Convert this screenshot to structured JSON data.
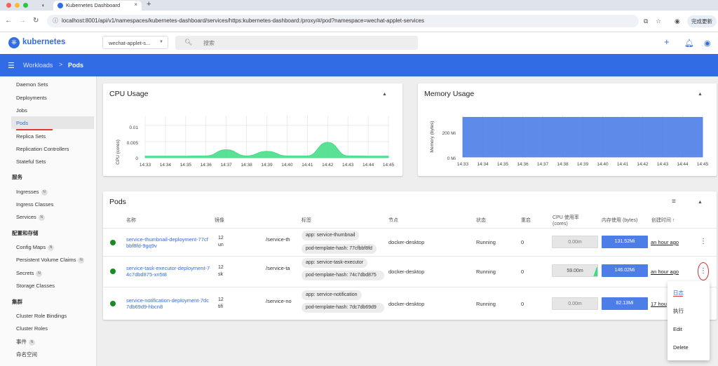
{
  "browser": {
    "tab_title": "Kubernetes Dashboard",
    "tab_close": "×",
    "new_tab": "+",
    "url": "localhost:8001/api/v1/namespaces/kubernetes-dashboard/services/https:kubernetes-dashboard:/proxy/#/pod?namespace=wechat-applet-services",
    "update_label": "完成更新"
  },
  "app": {
    "logo_text": "kubernetes",
    "namespace": "wechat-applet-s...",
    "search_placeholder": "搜索"
  },
  "breadcrumb": {
    "parent": "Workloads",
    "separator": ">",
    "current": "Pods"
  },
  "sidebar": {
    "workload_items": [
      {
        "label": "Daemon Sets"
      },
      {
        "label": "Deployments"
      },
      {
        "label": "Jobs"
      },
      {
        "label": "Pods"
      },
      {
        "label": "Replica Sets"
      },
      {
        "label": "Replication Controllers"
      },
      {
        "label": "Stateful Sets"
      }
    ],
    "service_header": "服务",
    "service_items": [
      {
        "label": "Ingresses",
        "badge": "N"
      },
      {
        "label": "Ingress Classes"
      },
      {
        "label": "Services",
        "badge": "N"
      }
    ],
    "config_header": "配置和存储",
    "config_items": [
      {
        "label": "Config Maps",
        "badge": "N"
      },
      {
        "label": "Persistent Volume Claims",
        "badge": "N"
      },
      {
        "label": "Secrets",
        "badge": "N"
      },
      {
        "label": "Storage Classes"
      }
    ],
    "cluster_header": "集群",
    "cluster_items": [
      {
        "label": "Cluster Role Bindings"
      },
      {
        "label": "Cluster Roles"
      },
      {
        "label": "事件",
        "badge": "N"
      },
      {
        "label": "命名空间"
      }
    ]
  },
  "cpu_chart": {
    "title": "CPU Usage",
    "ylabel": "CPU (cores)",
    "yticks": [
      "0.01",
      "0.005",
      "0"
    ]
  },
  "memory_chart": {
    "title": "Memory Usage",
    "ylabel": "Memory (bytes)",
    "yticks": [
      "200 Mi",
      "0 Mi"
    ]
  },
  "chart_data": [
    {
      "type": "area",
      "title": "CPU Usage",
      "ylabel": "CPU (cores)",
      "ylim": [
        0,
        0.013
      ],
      "yticks": [
        0,
        0.005,
        0.01
      ],
      "x": [
        "14:33",
        "14:34",
        "14:35",
        "14:36",
        "14:37",
        "14:38",
        "14:39",
        "14:40",
        "14:41",
        "14:42",
        "14:43",
        "14:44",
        "14:45"
      ],
      "series": [
        {
          "values": [
            0.0005,
            0.0005,
            0.0005,
            0.0006,
            0.0025,
            0.0006,
            0.002,
            0.0006,
            0.0006,
            0.0048,
            0.0006,
            0.0005,
            0.0005
          ]
        }
      ],
      "color": "#3ddc84"
    },
    {
      "type": "area",
      "title": "Memory Usage",
      "ylabel": "Memory (bytes)",
      "ylim": [
        0,
        360
      ],
      "yticks": [
        "0 Mi",
        "200 Mi"
      ],
      "x": [
        "14:33",
        "14:34",
        "14:35",
        "14:36",
        "14:37",
        "14:38",
        "14:39",
        "14:40",
        "14:41",
        "14:42",
        "14:43",
        "14:44",
        "14:45"
      ],
      "series": [
        {
          "values": [
            340,
            340,
            340,
            340,
            340,
            340,
            340,
            340,
            340,
            340,
            340,
            340,
            340
          ]
        }
      ],
      "color": "#4d7ee8"
    }
  ],
  "pods": {
    "title": "Pods",
    "headers": {
      "name": "名称",
      "image": "镜像",
      "labels": "标签",
      "node": "节点",
      "status": "状态",
      "restarts": "重启",
      "cpu": "CPU 使用率\n(cores)",
      "memory": "内存使用 (bytes)",
      "created": "创建时间 ↑"
    },
    "rows": [
      {
        "name": "service-thumbnail-deployment-77cfbbf8fd-9gq9v",
        "image_prefix": "12\nun",
        "image_fragment": "/service-th",
        "labels": [
          "app: service-thumbnail",
          "pod-template-hash: 77cfbbf8fd"
        ],
        "node": "docker-desktop",
        "status": "Running",
        "restarts": "0",
        "cpu": "0.00m",
        "memory": "131.52Mi",
        "age": "an hour ago"
      },
      {
        "name": "service-task-executor-deployment-74c7dbd875-xn5t8",
        "image_prefix": "12\nsk",
        "image_fragment": "/service-ta",
        "labels": [
          "app: service-task-executor",
          "pod-template-hash: 74c7dbd875"
        ],
        "node": "docker-desktop",
        "status": "Running",
        "restarts": "0",
        "cpu": "59.00m",
        "memory": "146.02Mi",
        "age": "an hour ago"
      },
      {
        "name": "service-notification-deployment-7dc7db69d9-hbcn8",
        "image_prefix": "12\ntifi",
        "image_fragment": "/service-no",
        "labels": [
          "app: service-notification",
          "pod-template-hash: 7dc7db69d9"
        ],
        "node": "docker-desktop",
        "status": "Running",
        "restarts": "0",
        "cpu": "0.00m",
        "memory": "82.13Mi",
        "age": "17 hou"
      }
    ]
  },
  "context_menu": {
    "items": [
      {
        "label": "日志"
      },
      {
        "label": "执行"
      },
      {
        "label": "Edit"
      },
      {
        "label": "Delete"
      }
    ]
  },
  "colors": {
    "brand": "#326ce5",
    "running": "#1a8a22",
    "cpu_area": "#3ddc84",
    "mem_bar": "#4d7ee8"
  }
}
